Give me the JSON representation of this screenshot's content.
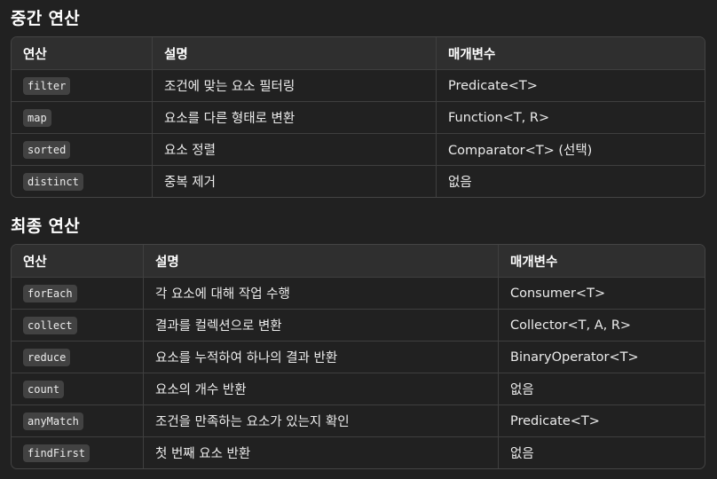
{
  "section1": {
    "title": "중간 연산",
    "headers": [
      "연산",
      "설명",
      "매개변수"
    ],
    "rows": [
      {
        "op": "filter",
        "desc": "조건에 맞는 요소 필터링",
        "param": "Predicate<T>"
      },
      {
        "op": "map",
        "desc": "요소를 다른 형태로 변환",
        "param": "Function<T, R>"
      },
      {
        "op": "sorted",
        "desc": "요소 정렬",
        "param": "Comparator<T> (선택)"
      },
      {
        "op": "distinct",
        "desc": "중복 제거",
        "param": "없음"
      }
    ]
  },
  "section2": {
    "title": "최종 연산",
    "headers": [
      "연산",
      "설명",
      "매개변수"
    ],
    "rows": [
      {
        "op": "forEach",
        "desc": "각 요소에 대해 작업 수행",
        "param": "Consumer<T>"
      },
      {
        "op": "collect",
        "desc": "결과를 컬렉션으로 변환",
        "param": "Collector<T, A, R>"
      },
      {
        "op": "reduce",
        "desc": "요소를 누적하여 하나의 결과 반환",
        "param": "BinaryOperator<T>"
      },
      {
        "op": "count",
        "desc": "요소의 개수 반환",
        "param": "없음"
      },
      {
        "op": "anyMatch",
        "desc": "조건을 만족하는 요소가 있는지 확인",
        "param": "Predicate<T>"
      },
      {
        "op": "findFirst",
        "desc": "첫 번째 요소 반환",
        "param": "없음"
      }
    ]
  }
}
